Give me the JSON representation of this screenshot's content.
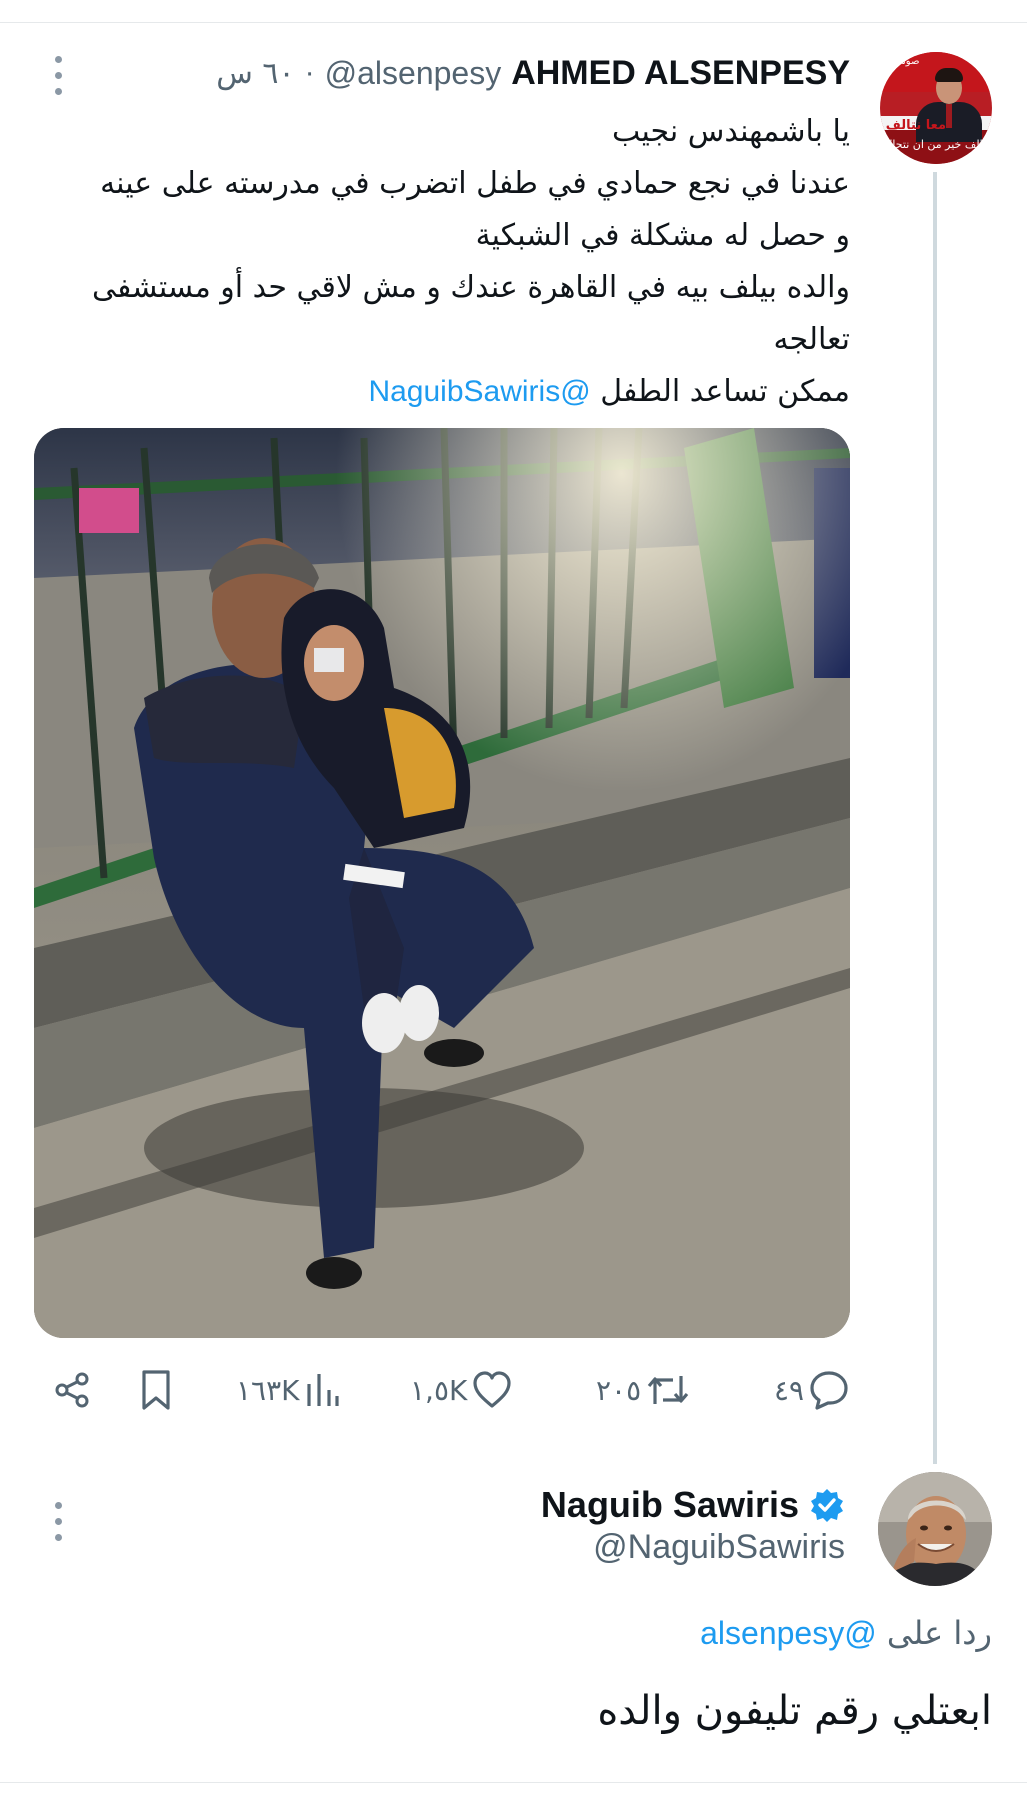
{
  "tweet": {
    "author_name": "AHMED ALSENPESY",
    "author_handle": "@alsenpesy",
    "time": "٦٠ س",
    "time_separator": "·",
    "avatar": {
      "text_top": "صوتك",
      "text_mid": "معا نتالف",
      "text_bottom": "تالف خير من ان نتحالف"
    },
    "text_lines": [
      "يا باشمهندس نجيب",
      "عندنا في نجع حمادي في طفل اتضرب في مدرسته على عينه",
      "و حصل له مشكلة في الشبكية",
      "والده بيلف بيه في القاهرة عندك و مش لاقي حد أو مستشفى",
      "تعالجه"
    ],
    "last_line_text": "ممكن تساعد الطفل",
    "last_line_mention": "@NaguibSawiris",
    "image_icon": "photo-man-with-child",
    "stats": {
      "replies": "٤٩",
      "retweets": "٢٠٥",
      "likes": "١,٥K",
      "views": "١٦٣K"
    },
    "icons": {
      "reply": "reply-icon",
      "retweet": "retweet-icon",
      "like": "heart-icon",
      "views": "views-icon",
      "bookmark": "bookmark-icon",
      "share": "share-icon"
    }
  },
  "reply": {
    "author_name": "Naguib Sawiris",
    "author_handle": "@NaguibSawiris",
    "verified_icon": "verified-badge-icon",
    "replying_to_prefix": "ردا على",
    "replying_to_handle": "@alsenpesy",
    "text": "ابعتلي رقم تليفون والده"
  },
  "colors": {
    "link": "#1d9bf0",
    "secondary_text": "#536471",
    "primary_text": "#0f1419",
    "thread_line": "#cfd9de"
  }
}
